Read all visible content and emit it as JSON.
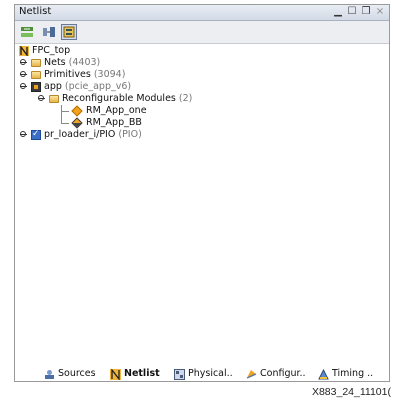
{
  "window": {
    "title": "Netlist"
  },
  "tree": {
    "root": "FPC_top",
    "nets": {
      "label": "Nets",
      "count": "(4403)"
    },
    "primitives": {
      "label": "Primitives",
      "count": "(3094)"
    },
    "app": {
      "label": "app",
      "type": "(pcie_app_v6)"
    },
    "reconfig": {
      "label": "Reconfigurable Modules",
      "count": "(2)"
    },
    "rm_one": "RM_App_one",
    "rm_bb": "RM_App_BB",
    "loader": {
      "label": "pr_loader_i/PIO",
      "type": "(PIO)"
    }
  },
  "tabs": [
    {
      "label": "Sources"
    },
    {
      "label": "Netlist"
    },
    {
      "label": "Physical.."
    },
    {
      "label": "Configur.."
    },
    {
      "label": "Timing .."
    }
  ],
  "caption": "X883_24_11101(",
  "colors": {
    "titlebar": "#d3dae6",
    "folder": "#e7b54b",
    "diamond": "#f4a11c"
  }
}
